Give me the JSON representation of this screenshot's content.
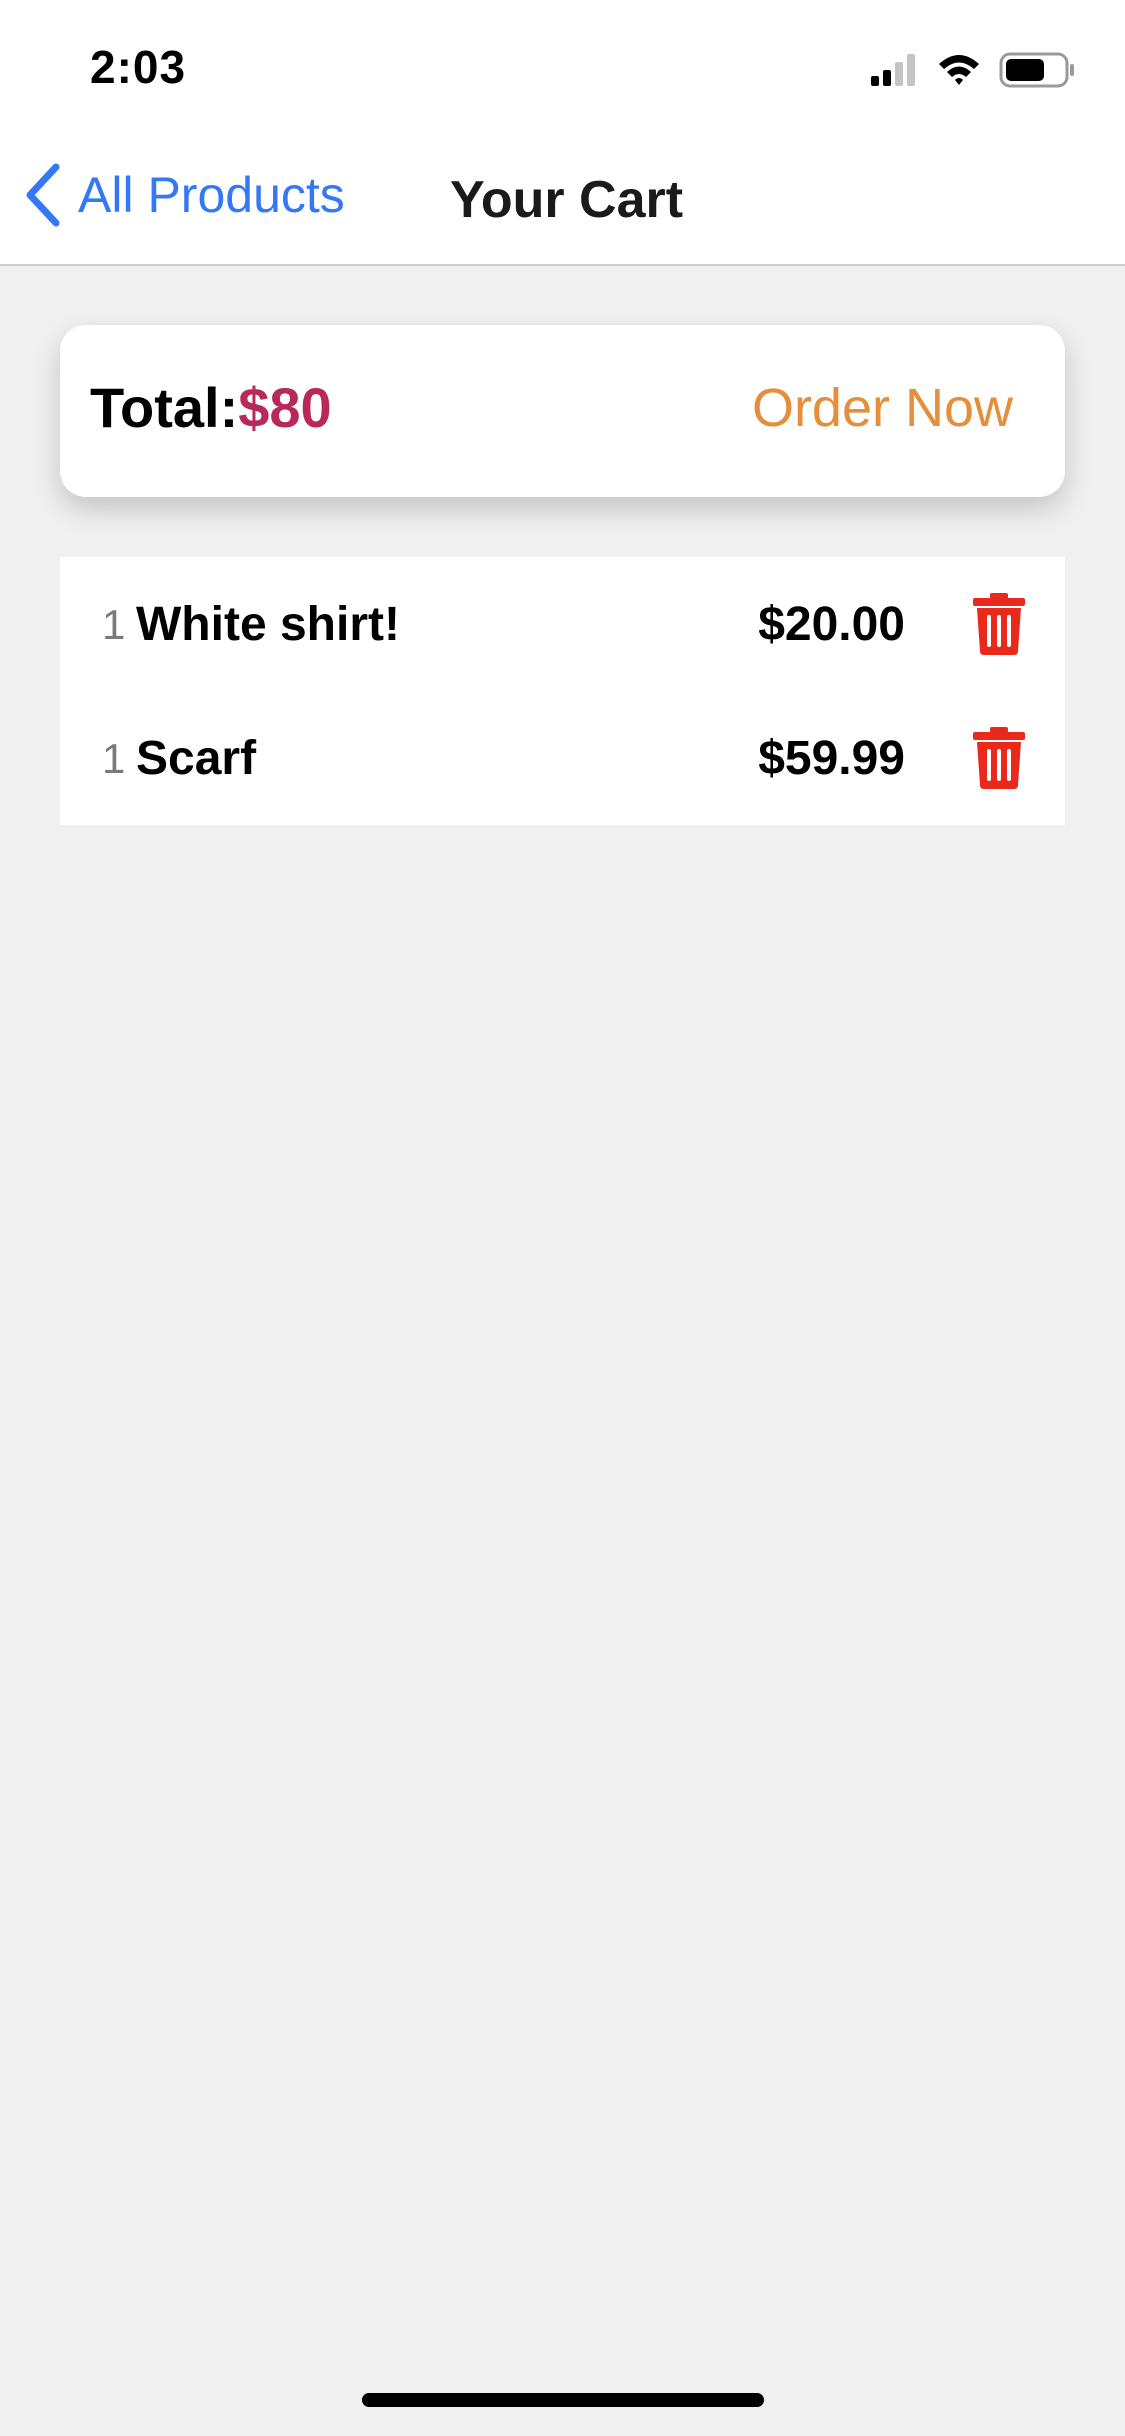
{
  "status_bar": {
    "time": "2:03",
    "signal_icon": "cellular-signal-icon",
    "wifi_icon": "wifi-icon",
    "battery_icon": "battery-icon"
  },
  "nav": {
    "back_label": "All Products",
    "back_icon": "chevron-left-icon",
    "title": "Your Cart",
    "accent_color": "#3478f6"
  },
  "summary": {
    "total_label": "Total:",
    "total_value": "$80",
    "total_color": "#b8285b",
    "order_label": "Order Now",
    "order_color": "#e58e3c"
  },
  "cart": {
    "items": [
      {
        "qty": "1",
        "name": "White shirt!",
        "price": "$20.00",
        "delete_icon": "trash-icon"
      },
      {
        "qty": "1",
        "name": "Scarf",
        "price": "$59.99",
        "delete_icon": "trash-icon"
      }
    ],
    "delete_color": "#e8291c"
  }
}
